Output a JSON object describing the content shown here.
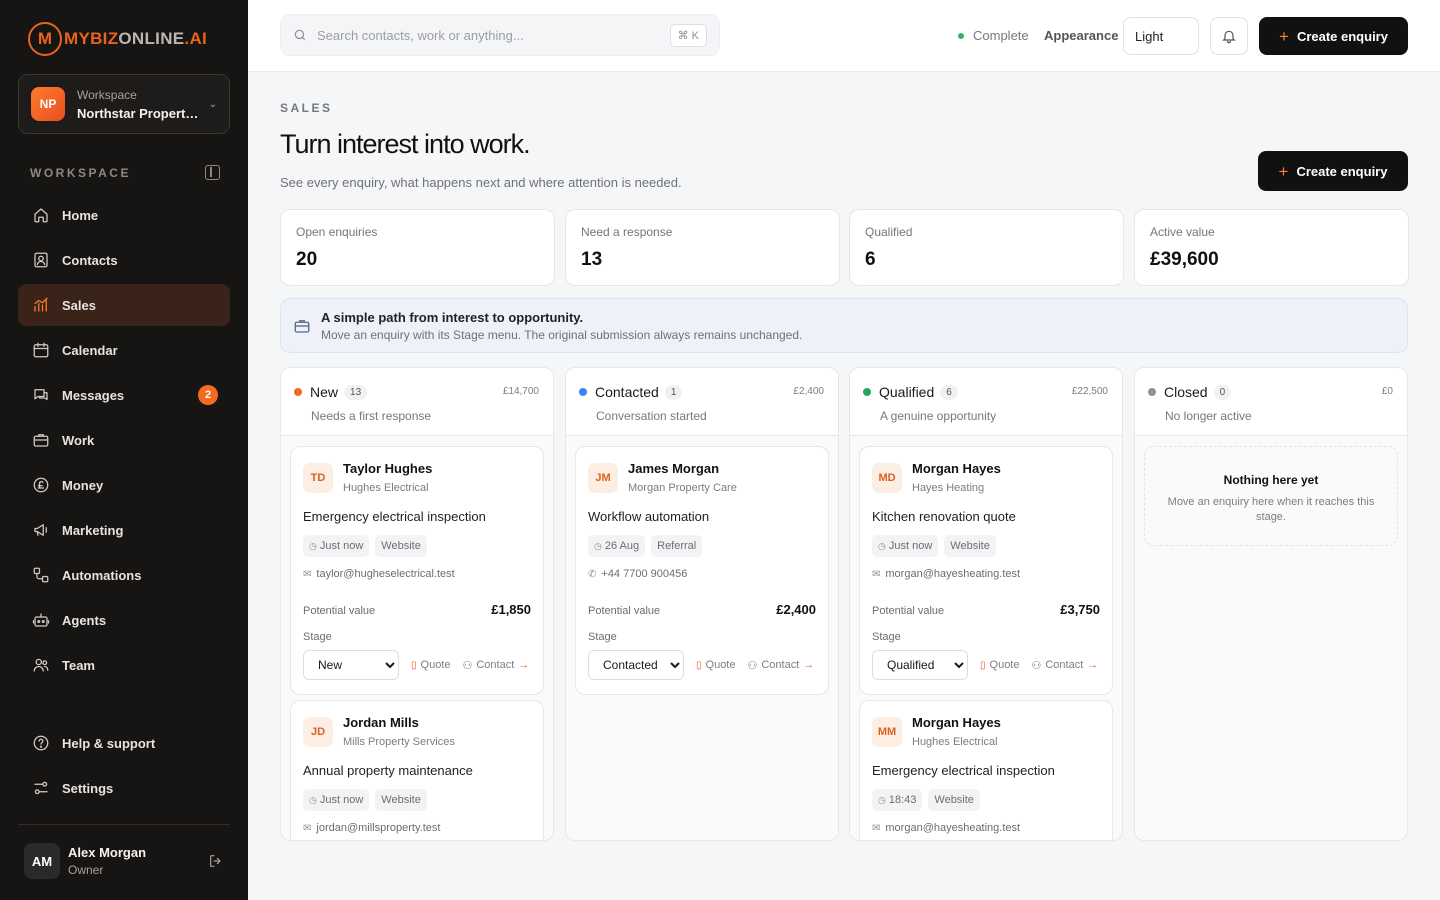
{
  "brand": {
    "mark": "M",
    "name_accent": "MYBIZ",
    "name_mid": "ONLINE",
    "name_tail": ".AI"
  },
  "workspace": {
    "initials": "NP",
    "label": "Workspace",
    "name": "Northstar Property Management"
  },
  "sidebar": {
    "section_label": "WORKSPACE",
    "items": [
      {
        "label": "Home",
        "icon": "home-icon"
      },
      {
        "label": "Contacts",
        "icon": "contacts-icon"
      },
      {
        "label": "Sales",
        "icon": "sales-chart-icon",
        "active": true
      },
      {
        "label": "Calendar",
        "icon": "calendar-icon"
      },
      {
        "label": "Messages",
        "icon": "messages-icon",
        "badge": "2"
      },
      {
        "label": "Work",
        "icon": "briefcase-icon"
      },
      {
        "label": "Money",
        "icon": "pound-icon"
      },
      {
        "label": "Marketing",
        "icon": "megaphone-icon"
      },
      {
        "label": "Automations",
        "icon": "automation-icon"
      },
      {
        "label": "Agents",
        "icon": "robot-icon"
      },
      {
        "label": "Team",
        "icon": "team-icon"
      }
    ],
    "footer_items": [
      {
        "label": "Help & support",
        "icon": "help-icon"
      },
      {
        "label": "Settings",
        "icon": "settings-icon"
      }
    ],
    "user": {
      "initials": "AM",
      "name": "Alex Morgan",
      "role": "Owner"
    }
  },
  "topbar": {
    "search_placeholder": "Search contacts, work or anything...",
    "shortcut": "⌘ K",
    "status": "Complete",
    "appearance_label": "Appearance",
    "appearance_value": "Light",
    "create_label": "Create enquiry"
  },
  "page": {
    "eyebrow": "SALES",
    "title": "Turn interest into work.",
    "subtitle": "See every enquiry, what happens next and where attention is needed.",
    "create_label": "Create enquiry"
  },
  "stats": [
    {
      "label": "Open enquiries",
      "value": "20"
    },
    {
      "label": "Need a response",
      "value": "13"
    },
    {
      "label": "Qualified",
      "value": "6"
    },
    {
      "label": "Active value",
      "value": "£39,600"
    }
  ],
  "banner": {
    "title": "A simple path from interest to opportunity.",
    "description": "Move an enquiry with its Stage menu. The original submission always remains unchanged."
  },
  "columns": [
    {
      "name": "New",
      "count": "13",
      "total": "£14,700",
      "subtitle": "Needs a first response",
      "dot_color": "#f26b21"
    },
    {
      "name": "Contacted",
      "count": "1",
      "total": "£2,400",
      "subtitle": "Conversation started",
      "dot_color": "#3b82f6"
    },
    {
      "name": "Qualified",
      "count": "6",
      "total": "£22,500",
      "subtitle": "A genuine opportunity",
      "dot_color": "#22a65a"
    },
    {
      "name": "Closed",
      "count": "0",
      "total": "£0",
      "subtitle": "No longer active",
      "dot_color": "#8e9198"
    }
  ],
  "cards": {
    "labels": {
      "potential_value": "Potential value",
      "stage": "Stage",
      "quote": "Quote",
      "contact": "Contact"
    },
    "new": [
      {
        "initials": "TD",
        "name": "Taylor Hughes",
        "company": "Hughes Electrical",
        "title": "Emergency electrical inspection",
        "time": "Just now",
        "source": "Website",
        "contact": "taylor@hugheselectrical.test",
        "contact_type": "email",
        "value": "£1,850",
        "stage": "New"
      },
      {
        "initials": "JD",
        "name": "Jordan Mills",
        "company": "Mills Property Services",
        "title": "Annual property maintenance",
        "time": "Just now",
        "source": "Website",
        "contact": "jordan@millsproperty.test",
        "contact_type": "email"
      }
    ],
    "contacted": [
      {
        "initials": "JM",
        "name": "James Morgan",
        "company": "Morgan Property Care",
        "title": "Workflow automation",
        "time": "26 Aug",
        "source": "Referral",
        "contact": "+44 7700 900456",
        "contact_type": "phone",
        "value": "£2,400",
        "stage": "Contacted"
      }
    ],
    "qualified": [
      {
        "initials": "MD",
        "name": "Morgan Hayes",
        "company": "Hayes Heating",
        "title": "Kitchen renovation quote",
        "time": "Just now",
        "source": "Website",
        "contact": "morgan@hayesheating.test",
        "contact_type": "email",
        "value": "£3,750",
        "stage": "Qualified"
      },
      {
        "initials": "MM",
        "name": "Morgan Hayes",
        "company": "Hughes Electrical",
        "title": "Emergency electrical inspection",
        "time": "18:43",
        "source": "Website",
        "contact": "morgan@hayesheating.test",
        "contact_type": "email"
      }
    ],
    "stage_options": [
      "New",
      "Contacted",
      "Qualified",
      "Closed"
    ]
  },
  "empty_closed": {
    "title": "Nothing here yet",
    "description": "Move an enquiry here when it reaches this stage."
  }
}
